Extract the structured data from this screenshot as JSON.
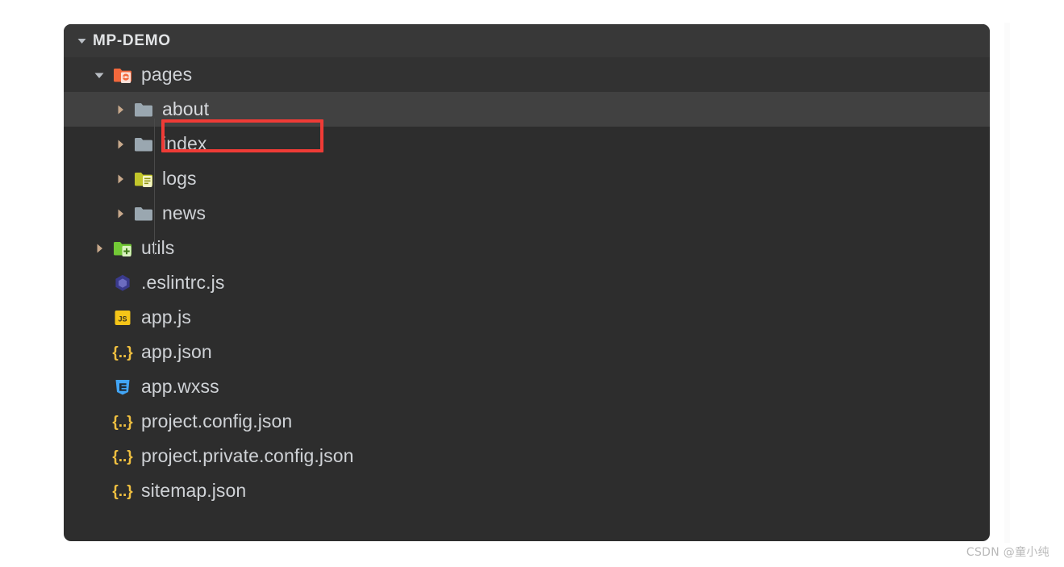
{
  "panel": {
    "background_color": "#2d2d2d",
    "highlight_color": "#414141",
    "header_row_color": "#383838",
    "annotation_color": "#ef3b36"
  },
  "tree": {
    "root": {
      "label": "MP-DEMO",
      "expanded": true,
      "twisty": "chevron-down-icon"
    },
    "items": [
      {
        "label": "pages",
        "depth": 1,
        "type": "folder",
        "icon": "folder-pages-icon",
        "icon_color": "#f2683c",
        "expanded": true,
        "twisty": "chevron-down-icon",
        "selected": false,
        "annotated": false
      },
      {
        "label": "about",
        "depth": 2,
        "type": "folder",
        "icon": "folder-icon",
        "icon_color": "#9aa7b0",
        "expanded": false,
        "twisty": "chevron-right-icon",
        "selected": true,
        "annotated": true
      },
      {
        "label": "index",
        "depth": 2,
        "type": "folder",
        "icon": "folder-icon",
        "icon_color": "#9aa7b0",
        "expanded": false,
        "twisty": "chevron-right-icon",
        "selected": false,
        "annotated": false
      },
      {
        "label": "logs",
        "depth": 2,
        "type": "folder",
        "icon": "folder-logs-icon",
        "icon_color": "#c2c62b",
        "expanded": false,
        "twisty": "chevron-right-icon",
        "selected": false,
        "annotated": false
      },
      {
        "label": "news",
        "depth": 2,
        "type": "folder",
        "icon": "folder-icon",
        "icon_color": "#9aa7b0",
        "expanded": false,
        "twisty": "chevron-right-icon",
        "selected": false,
        "annotated": false
      },
      {
        "label": "utils",
        "depth": 1,
        "type": "folder",
        "icon": "folder-utils-icon",
        "icon_color": "#73c936",
        "expanded": false,
        "twisty": "chevron-right-icon",
        "selected": false,
        "annotated": false
      },
      {
        "label": ".eslintrc.js",
        "depth": 1,
        "type": "file",
        "icon": "eslint-icon",
        "icon_color": "#4b32c3",
        "twisty": "none",
        "selected": false,
        "annotated": false
      },
      {
        "label": "app.js",
        "depth": 1,
        "type": "file",
        "icon": "javascript-icon",
        "icon_color": "#f5c518",
        "twisty": "none",
        "selected": false,
        "annotated": false
      },
      {
        "label": "app.json",
        "depth": 1,
        "type": "file",
        "icon": "json-icon",
        "icon_color": "#f0c040",
        "twisty": "none",
        "selected": false,
        "annotated": false
      },
      {
        "label": "app.wxss",
        "depth": 1,
        "type": "file",
        "icon": "css-icon",
        "icon_color": "#42a5f5",
        "twisty": "none",
        "selected": false,
        "annotated": false
      },
      {
        "label": "project.config.json",
        "depth": 1,
        "type": "file",
        "icon": "json-icon",
        "icon_color": "#f0c040",
        "twisty": "none",
        "selected": false,
        "annotated": false
      },
      {
        "label": "project.private.config.json",
        "depth": 1,
        "type": "file",
        "icon": "json-icon",
        "icon_color": "#f0c040",
        "twisty": "none",
        "selected": false,
        "annotated": false
      },
      {
        "label": "sitemap.json",
        "depth": 1,
        "type": "file",
        "icon": "json-icon",
        "icon_color": "#f0c040",
        "twisty": "none",
        "selected": false,
        "annotated": false
      }
    ]
  },
  "watermark": {
    "text": "CSDN @童小纯"
  }
}
